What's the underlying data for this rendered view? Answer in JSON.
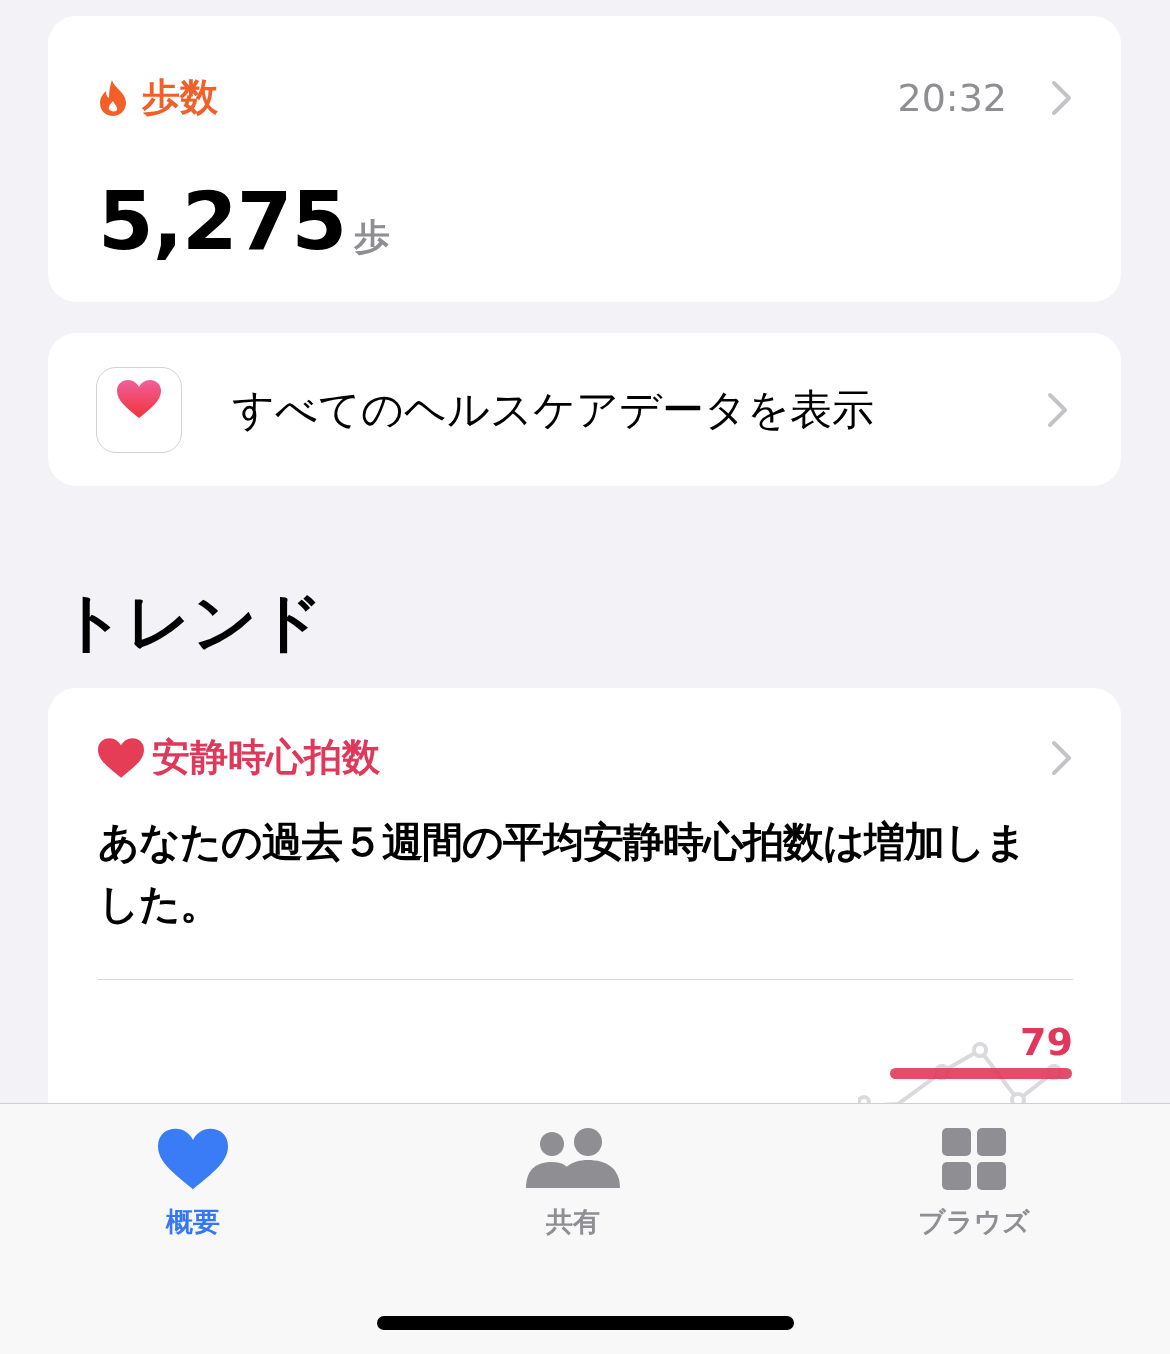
{
  "steps_card": {
    "title": "歩数",
    "time": "20:32",
    "value": "5,275",
    "unit": "歩"
  },
  "all_data_link": {
    "label": "すべてのヘルスケアデータを表示"
  },
  "section_title": "トレンド",
  "trend_card": {
    "title": "安静時心拍数",
    "message": "あなたの過去５週間の平均安静時心拍数は増加しました。",
    "reading": "79"
  },
  "tabs": [
    {
      "label": "概要",
      "kind": "heart",
      "selected": true
    },
    {
      "label": "共有",
      "kind": "people",
      "selected": false
    },
    {
      "label": "ブラウズ",
      "kind": "grid",
      "selected": false
    }
  ]
}
